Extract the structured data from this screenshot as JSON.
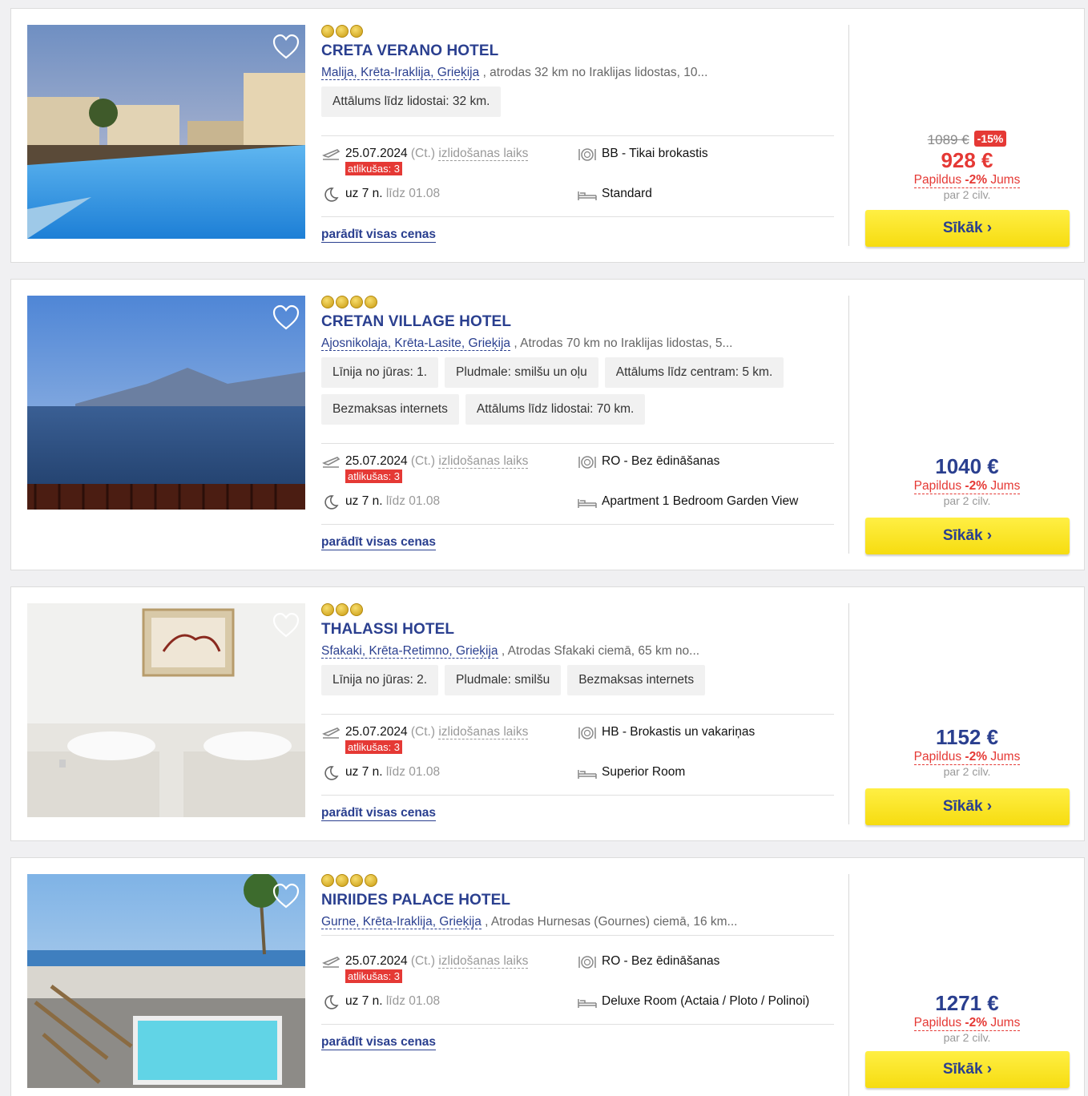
{
  "common": {
    "departure_note": "(Ct.)",
    "departure_label": "izlidošanas laiks",
    "nights_prefix": "uz",
    "until_label": "līdz",
    "extra_label": "Papildus",
    "extra_discount": "-2%",
    "extra_you": "Jums",
    "per_people": "par 2 cilv.",
    "details_button": "Sīkāk",
    "show_prices": "parādīt visas cenas"
  },
  "hotels": [
    {
      "stars": 3,
      "name": "CRETA VERANO HOTEL",
      "location_link": "Malija, Krēta-Iraklija, Grieķija",
      "location_desc": ", atrodas 32 km no Iraklijas lidostas, 10...",
      "tags": [
        "Attālums līdz lidostai: 32 km."
      ],
      "date": "25.07.2024",
      "seats_left": "atlikušas: 3",
      "nights": "7 n.",
      "until": "01.08",
      "meal": "BB - Tikai brokastis",
      "room": "Standard",
      "old_price": "1089 €",
      "discount": "-15%",
      "price": "928 €"
    },
    {
      "stars": 4,
      "name": "CRETAN VILLAGE HOTEL",
      "location_link": "Ajosnikolaja, Krēta-Lasite, Grieķija",
      "location_desc": ", Atrodas 70 km no Iraklijas lidostas, 5...",
      "tags": [
        "Līnija no jūras: 1.",
        "Pludmale: smilšu un oļu",
        "Attālums līdz centram: 5 km.",
        "Bezmaksas internets",
        "Attālums līdz lidostai: 70 km."
      ],
      "date": "25.07.2024",
      "seats_left": "atlikušas: 3",
      "nights": "7 n.",
      "until": "01.08",
      "meal": "RO - Bez ēdināšanas",
      "room": "Apartment 1 Bedroom Garden View",
      "price": "1040 €"
    },
    {
      "stars": 3,
      "name": "THALASSI HOTEL",
      "location_link": "Sfakaki, Krēta-Retimno, Grieķija",
      "location_desc": ", Atrodas Sfakaki ciemā, 65 km no...",
      "tags": [
        "Līnija no jūras: 2.",
        "Pludmale: smilšu",
        "Bezmaksas internets"
      ],
      "date": "25.07.2024",
      "seats_left": "atlikušas: 3",
      "nights": "7 n.",
      "until": "01.08",
      "meal": "HB - Brokastis un vakariņas",
      "room": "Superior Room",
      "price": "1152 €"
    },
    {
      "stars": 4,
      "name": "NIRIIDES PALACE HOTEL",
      "location_link": "Gurne, Krēta-Iraklija, Grieķija",
      "location_desc": ", Atrodas Hurnesas (Gournes) ciemā, 16 km...",
      "tags": [],
      "date": "25.07.2024",
      "seats_left": "atlikušas: 3",
      "nights": "7 n.",
      "until": "01.08",
      "meal": "RO - Bez ēdināšanas",
      "room": "Deluxe Room (Actaia / Ploto / Polinoi)",
      "price": "1271 €"
    }
  ]
}
